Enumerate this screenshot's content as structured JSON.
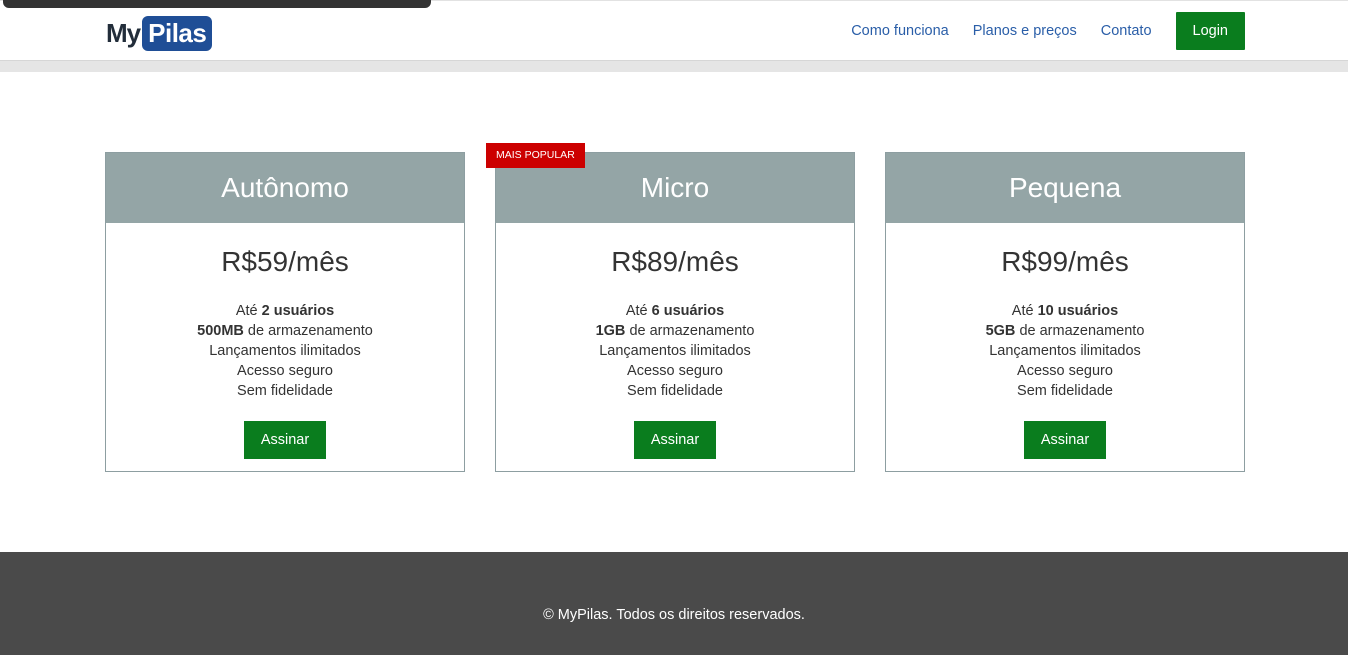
{
  "header": {
    "logo": {
      "my": "My",
      "pilas": "Pilas"
    },
    "nav": [
      {
        "label": "Como funciona"
      },
      {
        "label": "Planos e preços"
      },
      {
        "label": "Contato"
      }
    ],
    "login_label": "Login"
  },
  "badge": "MAIS POPULAR",
  "plans": [
    {
      "name": "Autônomo",
      "price": "R$59/mês",
      "users_prefix": "Até",
      "users": "2 usuários",
      "storage": "500MB",
      "storage_suffix": "de armazenamento",
      "feature3": "Lançamentos ilimitados",
      "feature4": "Acesso seguro",
      "feature5": "Sem fidelidade",
      "button": "Assinar"
    },
    {
      "name": "Micro",
      "price": "R$89/mês",
      "users_prefix": "Até",
      "users": "6 usuários",
      "storage": "1GB",
      "storage_suffix": "de armazenamento",
      "feature3": "Lançamentos ilimitados",
      "feature4": "Acesso seguro",
      "feature5": "Sem fidelidade",
      "button": "Assinar"
    },
    {
      "name": "Pequena",
      "price": "R$99/mês",
      "users_prefix": "Até",
      "users": "10 usuários",
      "storage": "5GB",
      "storage_suffix": "de armazenamento",
      "feature3": "Lançamentos ilimitados",
      "feature4": "Acesso seguro",
      "feature5": "Sem fidelidade",
      "button": "Assinar"
    }
  ],
  "footer": {
    "text": "© MyPilas. Todos os direitos reservados."
  },
  "colors": {
    "brand_blue": "#1f4e96",
    "button_green": "#0a7d1e",
    "card_header": "#94a5a6",
    "badge_red": "#cc0000",
    "footer_bg": "#4a4a4a"
  }
}
